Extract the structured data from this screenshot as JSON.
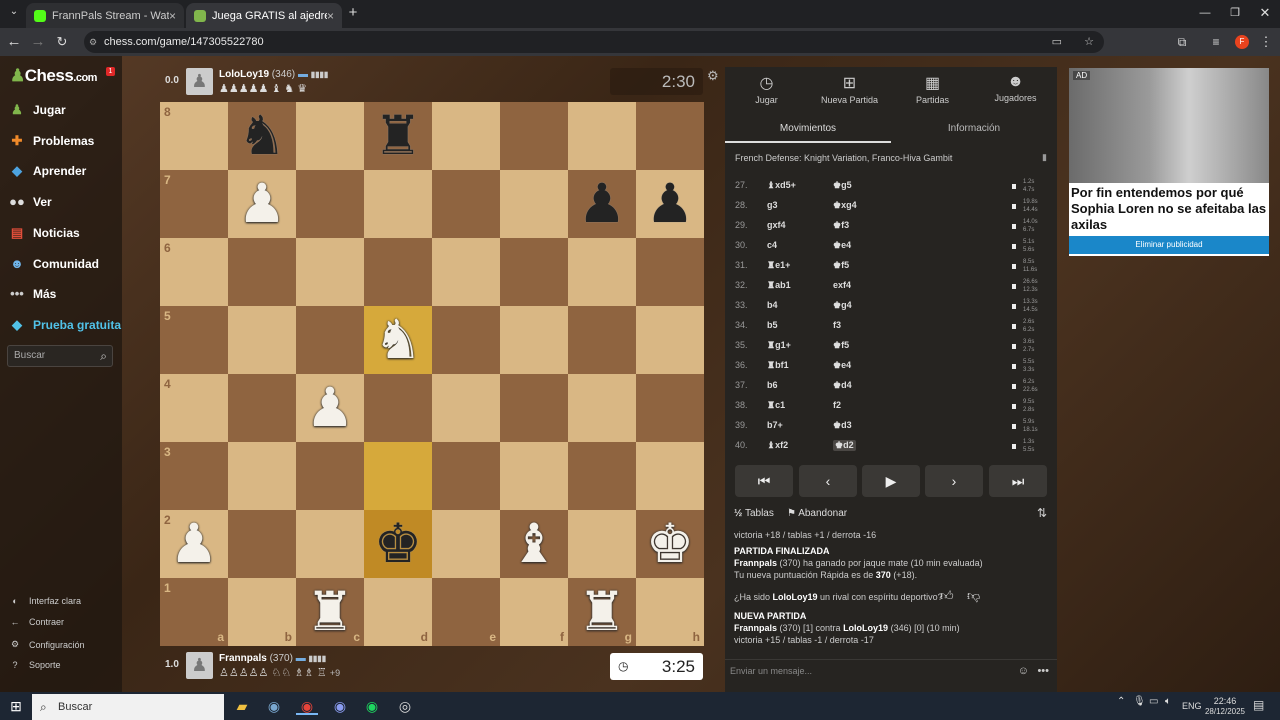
{
  "browser": {
    "tabs": [
      {
        "title": "FrannPals Stream - Watch Live ...",
        "active": false
      },
      {
        "title": "Juega GRATIS al ajedrez online ...",
        "active": true
      }
    ],
    "url": "chess.com/game/147305522780",
    "profile_initial": "F"
  },
  "nav": {
    "logo_prefix": "Chess",
    "logo_suffix": ".com",
    "notif": "1",
    "items": [
      {
        "label": "Jugar",
        "icon": "pawn-icon"
      },
      {
        "label": "Problemas",
        "icon": "puzzle-icon"
      },
      {
        "label": "Aprender",
        "icon": "graduation-icon"
      },
      {
        "label": "Ver",
        "icon": "binoculars-icon"
      },
      {
        "label": "Noticias",
        "icon": "news-icon"
      },
      {
        "label": "Comunidad",
        "icon": "people-icon"
      },
      {
        "label": "Más",
        "icon": "more-icon"
      },
      {
        "label": "Prueba gratuita",
        "icon": "diamond-icon"
      }
    ],
    "search_placeholder": "Buscar",
    "bottom": [
      {
        "label": "Interfaz clara",
        "icon": "theme-icon"
      },
      {
        "label": "Contraer",
        "icon": "collapse-icon"
      },
      {
        "label": "Configuración",
        "icon": "gear-icon"
      },
      {
        "label": "Soporte",
        "icon": "help-icon"
      }
    ]
  },
  "game": {
    "top": {
      "score": "0.0",
      "name": "LoloLoy19",
      "rating": "(346)",
      "captured": "♟♟♟♟♟ ♝ ♞ ♛",
      "clock": "2:30"
    },
    "bottom": {
      "score": "1.0",
      "name": "Frannpals",
      "rating": "(370)",
      "captured": "♙♙♙♙♙ ♘♘ ♗♗ ♖",
      "advantage": "+9",
      "clock": "3:25"
    },
    "files": [
      "a",
      "b",
      "c",
      "d",
      "e",
      "f",
      "g",
      "h"
    ],
    "ranks": [
      "8",
      "7",
      "6",
      "5",
      "4",
      "3",
      "2",
      "1"
    ],
    "pieces": {
      "b8": "bn",
      "d8": "br",
      "b7": "wp",
      "g7": "bp",
      "h7": "bp",
      "d5": "wn",
      "c4": "wp",
      "a2": "wp",
      "d2": "bk",
      "f2": "wb",
      "h2": "wk",
      "c1": "wr",
      "g1": "wr"
    },
    "highlight": [
      "d5",
      "d3",
      "d2"
    ]
  },
  "panel": {
    "tabs": [
      {
        "label": "Jugar",
        "icon": "clock-icon"
      },
      {
        "label": "Nueva Partida",
        "icon": "plus-icon"
      },
      {
        "label": "Partidas",
        "icon": "board-icon"
      },
      {
        "label": "Jugadores",
        "icon": "people-icon"
      }
    ],
    "subtabs": [
      "Movimientos",
      "Información"
    ],
    "opening": "French Defense: Knight Variation, Franco-Hiva Gambit",
    "moves": [
      {
        "n": "27.",
        "w": "♝xd5+",
        "b": "♚g5",
        "t": [
          "1.2s",
          "4.7s"
        ]
      },
      {
        "n": "28.",
        "w": "g3",
        "b": "♚xg4",
        "t": [
          "19.8s",
          "14.4s"
        ]
      },
      {
        "n": "29.",
        "w": "gxf4",
        "b": "♚f3",
        "t": [
          "14.0s",
          "6.7s"
        ]
      },
      {
        "n": "30.",
        "w": "c4",
        "b": "♚e4",
        "t": [
          "5.1s",
          "5.6s"
        ]
      },
      {
        "n": "31.",
        "w": "♜e1+",
        "b": "♚f5",
        "t": [
          "8.5s",
          "11.6s"
        ]
      },
      {
        "n": "32.",
        "w": "♜ab1",
        "b": "exf4",
        "t": [
          "26.6s",
          "12.3s"
        ]
      },
      {
        "n": "33.",
        "w": "b4",
        "b": "♚g4",
        "t": [
          "13.3s",
          "14.5s"
        ]
      },
      {
        "n": "34.",
        "w": "b5",
        "b": "f3",
        "t": [
          "2.6s",
          "6.2s"
        ]
      },
      {
        "n": "35.",
        "w": "♜g1+",
        "b": "♚f5",
        "t": [
          "3.6s",
          "2.7s"
        ]
      },
      {
        "n": "36.",
        "w": "♜bf1",
        "b": "♚e4",
        "t": [
          "5.5s",
          "3.3s"
        ]
      },
      {
        "n": "37.",
        "w": "b6",
        "b": "♚d4",
        "t": [
          "6.2s",
          "22.6s"
        ]
      },
      {
        "n": "38.",
        "w": "♜c1",
        "b": "f2",
        "t": [
          "9.5s",
          "2.8s"
        ]
      },
      {
        "n": "39.",
        "w": "b7+",
        "b": "♚d3",
        "t": [
          "5.9s",
          "18.1s"
        ]
      },
      {
        "n": "40.",
        "w": "♝xf2",
        "b": "♚d2",
        "t": [
          "1.3s",
          "5.5s"
        ]
      }
    ],
    "draw": "Tablas",
    "resign": "Abandonar",
    "rec1": "victoria +18 / tablas +1 / derrota -16",
    "finished": "PARTIDA FINALIZADA",
    "result_name": "Frannpals",
    "result_rest": " (370) ha ganado por jaque mate (10 min evaluada)",
    "rating_pre": "Tu nueva puntuación Rápida es de ",
    "rating_val": "370",
    "rating_post": " (+18).",
    "q_pre": "¿Ha sido ",
    "q_name": "LoloLoy19",
    "q_post": " un rival con espíritu deportivo?",
    "new_game": "NUEVA PARTIDA",
    "ng_name1": "Frannpals",
    "ng_mid": " (370) [1] contra ",
    "ng_name2": "LoloLoy19",
    "ng_post": " (346) [0] (10 min)",
    "rec2": "victoria +15 / tablas -1 / derrota -17",
    "message_placeholder": "Enviar un mensaje..."
  },
  "ad": {
    "tag": "AD",
    "title": "Por fin entendemos por qué Sophia Loren no se afeitaba las axilas",
    "button": "Eliminar publicidad"
  },
  "taskbar": {
    "search": "Buscar",
    "lang": "ENG",
    "time": "22:46",
    "date": "28/12/2025"
  }
}
